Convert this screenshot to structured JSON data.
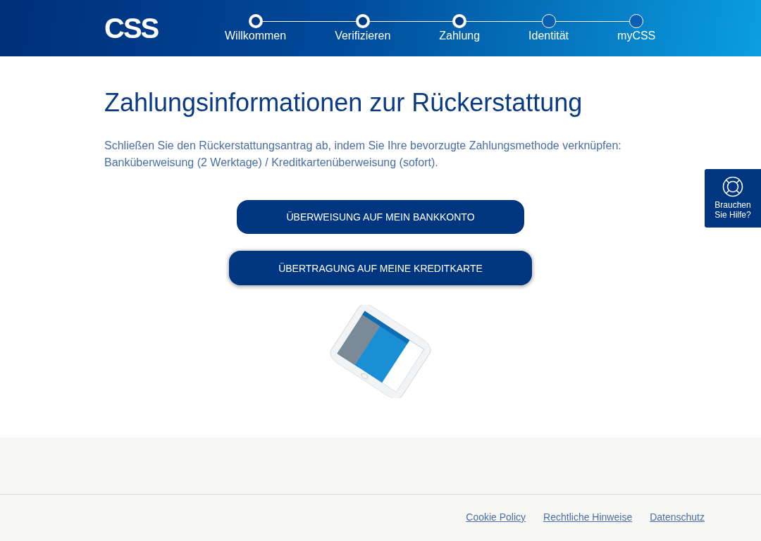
{
  "logo": "CSS",
  "steps": [
    {
      "label": "Willkommen",
      "completed": true
    },
    {
      "label": "Verifizieren",
      "completed": true
    },
    {
      "label": "Zahlung",
      "completed": true
    },
    {
      "label": "Identität",
      "completed": false
    },
    {
      "label": "myCSS",
      "completed": false
    }
  ],
  "title": "Zahlungsinformationen zur Rückerstattung",
  "intro": "Schließen Sie den Rückerstattungsantrag ab, indem Sie Ihre bevorzugte Zahlungsmethode verknüpfen: Banküberweisung (2 Werktage) / Kreditkartenüberweisung (sofort).",
  "buttons": [
    {
      "label": "ÜBERWEISUNG AUF MEIN BANKKONTO",
      "focused": false
    },
    {
      "label": "ÜBERTRAGUNG AUF MEINE KREDITKARTE",
      "focused": true
    }
  ],
  "help": {
    "line1": "Brauchen",
    "line2": "Sie Hilfe?"
  },
  "footer_links": [
    "Cookie Policy",
    "Rechtliche Hinweise",
    "Datenschutz"
  ]
}
